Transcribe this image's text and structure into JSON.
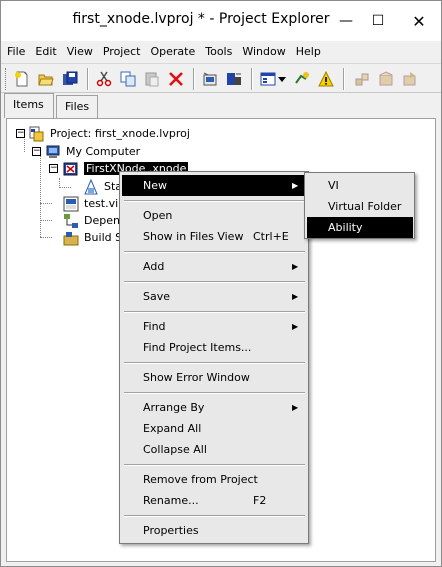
{
  "window": {
    "title": "first_xnode.lvproj * - Project Explorer",
    "minimize_glyph": "—",
    "maximize_glyph": "☐",
    "close_glyph": "✕"
  },
  "menubar": [
    "File",
    "Edit",
    "View",
    "Project",
    "Operate",
    "Tools",
    "Window",
    "Help"
  ],
  "tabs": [
    {
      "label": "Items",
      "active": true
    },
    {
      "label": "Files",
      "active": false
    }
  ],
  "tree": {
    "project": "Project: first_xnode.lvproj",
    "computer": "My Computer",
    "xnode": "FirstXNode .xnode",
    "state": "Sta",
    "test_vi": "test.vi",
    "dependencies": "Depen",
    "build": "Build S"
  },
  "context_menu": {
    "new": "New",
    "open": "Open",
    "show_in_files_view": "Show in Files View",
    "show_in_files_view_shortcut": "Ctrl+E",
    "add": "Add",
    "save": "Save",
    "find": "Find",
    "find_project_items": "Find Project Items...",
    "show_error_window": "Show Error Window",
    "arrange_by": "Arrange By",
    "expand_all": "Expand All",
    "collapse_all": "Collapse All",
    "remove_from_project": "Remove from Project",
    "rename": "Rename...",
    "rename_shortcut": "F2",
    "properties": "Properties",
    "submenu_arrow": "▶"
  },
  "submenu": {
    "vi": "VI",
    "virtual_folder": "Virtual Folder",
    "ability": "Ability"
  },
  "colors": {
    "highlight": "#000000",
    "menu_bg": "#e8e8e8",
    "window_bg": "#f0f0f0"
  }
}
